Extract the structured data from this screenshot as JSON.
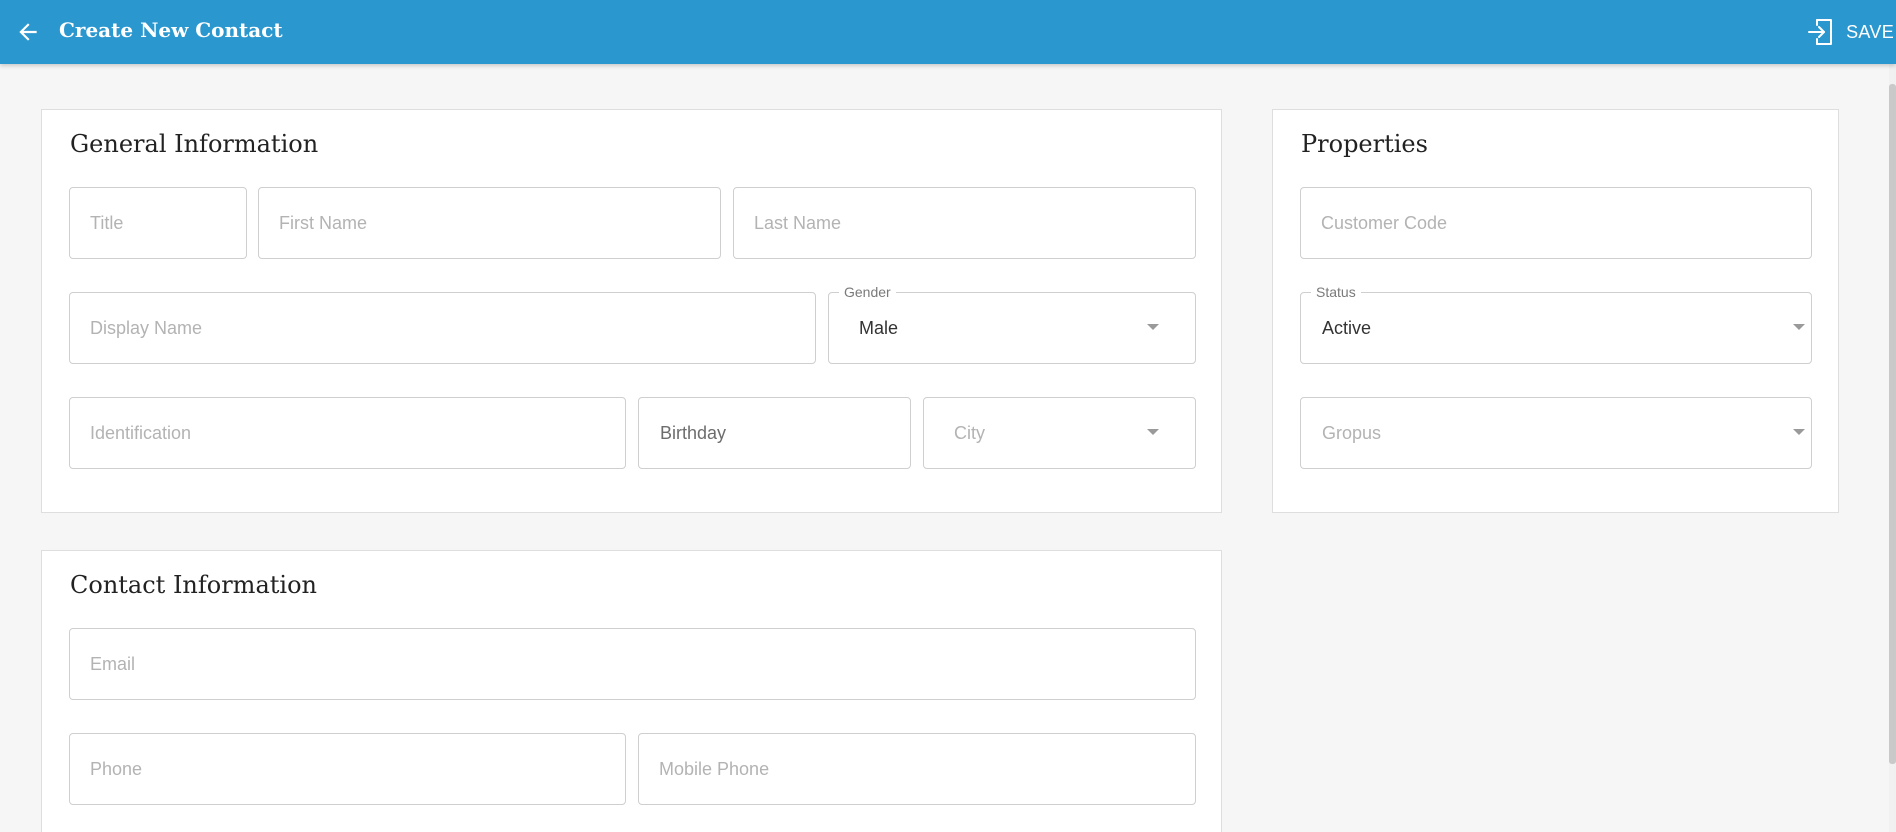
{
  "header": {
    "title": "Create New Contact",
    "back_icon": "arrow-left-icon",
    "save_icon": "sign-in-icon",
    "save_label": "SAVE",
    "background_color": "#2b97cf"
  },
  "general_information": {
    "title": "General Information",
    "title_field": {
      "placeholder": "Title",
      "value": ""
    },
    "first_name": {
      "placeholder": "First Name",
      "value": ""
    },
    "last_name": {
      "placeholder": "Last Name",
      "value": ""
    },
    "display_name": {
      "placeholder": "Display Name",
      "value": ""
    },
    "gender": {
      "label": "Gender",
      "value": "Male"
    },
    "identification": {
      "placeholder": "Identification",
      "value": ""
    },
    "birthday": {
      "value": "Birthday"
    },
    "city": {
      "placeholder": "City"
    }
  },
  "properties": {
    "title": "Properties",
    "customer_code": {
      "placeholder": "Customer Code",
      "value": ""
    },
    "status": {
      "label": "Status",
      "value": "Active"
    },
    "groups": {
      "placeholder": "Gropus"
    }
  },
  "contact_information": {
    "title": "Contact Information",
    "email": {
      "placeholder": "Email",
      "value": ""
    },
    "phone": {
      "placeholder": "Phone",
      "value": ""
    },
    "mobile_phone": {
      "placeholder": "Mobile Phone",
      "value": ""
    }
  }
}
